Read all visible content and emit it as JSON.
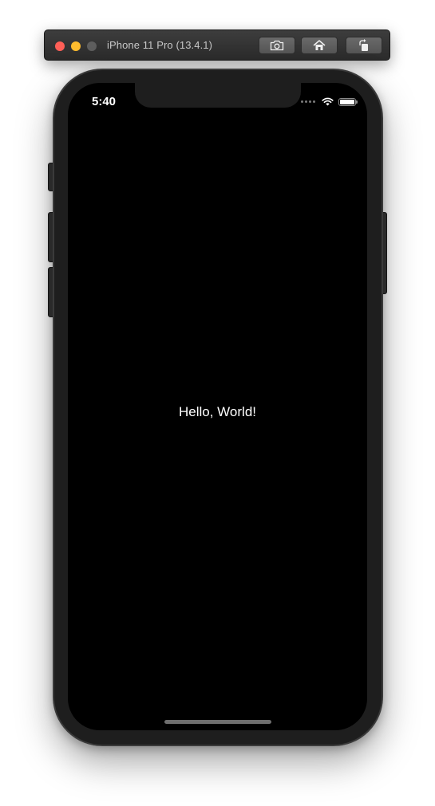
{
  "window": {
    "title": "iPhone 11 Pro (13.4.1)",
    "controls": {
      "close_color": "#ff5f57",
      "minimize_color": "#febc2e",
      "zoom_color": "#5e5e5e"
    },
    "toolbar": [
      {
        "name": "screenshot",
        "icon": "camera-icon"
      },
      {
        "name": "home",
        "icon": "home-icon"
      },
      {
        "name": "rotate",
        "icon": "rotate-icon"
      }
    ]
  },
  "status_bar": {
    "time": "5:40",
    "icons": [
      "cellular-signal-icon",
      "wifi-icon",
      "battery-icon"
    ],
    "battery_level": 1.0
  },
  "screen": {
    "background": "#000000",
    "message": "Hello, World!"
  }
}
